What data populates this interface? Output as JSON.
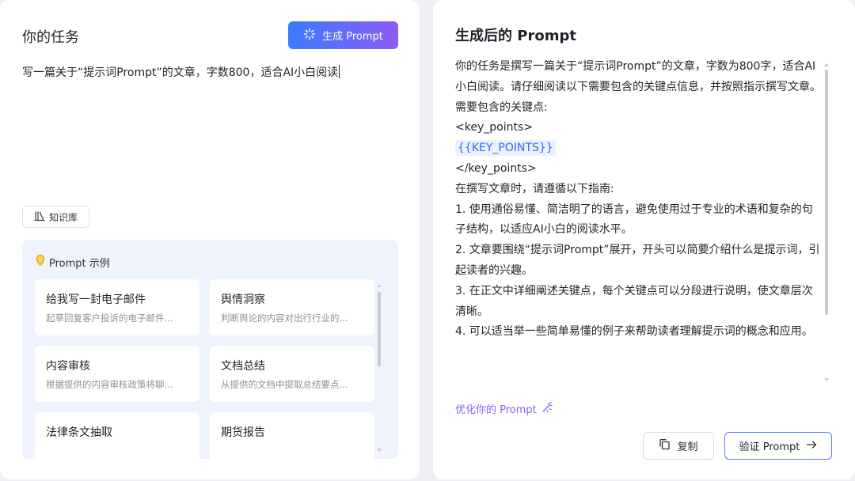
{
  "left": {
    "title": "你的任务",
    "generate_button": "生成 Prompt",
    "task_text": "写一篇关于“提示词Prompt”的文章，字数800，适合AI小白阅读",
    "knowledge_base_button": "知识库",
    "examples": {
      "title": "Prompt 示例",
      "cards": [
        {
          "title": "给我写一封电子邮件",
          "desc": "起草回复客户投诉的电子邮件..."
        },
        {
          "title": "舆情洞察",
          "desc": "判断舆论的内容对出行行业的..."
        },
        {
          "title": "内容审核",
          "desc": "根据提供的内容审核政策将聊..."
        },
        {
          "title": "文档总结",
          "desc": "从提供的文档中提取总结要点..."
        },
        {
          "title": "法律条文抽取",
          "desc": ""
        },
        {
          "title": "期货报告",
          "desc": ""
        }
      ]
    }
  },
  "right": {
    "title": "生成后的 Prompt",
    "lines": [
      "你的任务是撰写一篇关于“提示词Prompt”的文章，字数为800字，适合AI小白阅读。请仔细阅读以下需要包含的关键点信息，并按照指示撰写文章。",
      "需要包含的关键点:",
      "<key_points>",
      "{{KEY_POINTS}}",
      "</key_points>",
      "在撰写文章时，请遵循以下指南:",
      "1. 使用通俗易懂、简洁明了的语言，避免使用过于专业的术语和复杂的句子结构，以适应AI小白的阅读水平。",
      "2. 文章要围绕“提示词Prompt”展开，开头可以简要介绍什么是提示词，引起读者的兴趣。",
      "3. 在正文中详细阐述关键点，每个关键点可以分段进行说明，使文章层次清晰。",
      "4. 可以适当举一些简单易懂的例子来帮助读者理解提示词的概念和应用。"
    ],
    "optimize_link": "优化你的 Prompt",
    "copy_button": "复制",
    "verify_button": "验证 Prompt"
  },
  "colors": {
    "accent_blue": "#3c7bff",
    "accent_purple": "#8b5cf6",
    "variable_highlight": "#2f6bff"
  },
  "icons": {
    "generate": "sparkle-icon",
    "knowledge_base": "books-icon",
    "examples": "lightbulb-icon",
    "optimize": "magic-wand-icon",
    "copy": "copy-icon",
    "verify": "arrow-right-icon"
  }
}
